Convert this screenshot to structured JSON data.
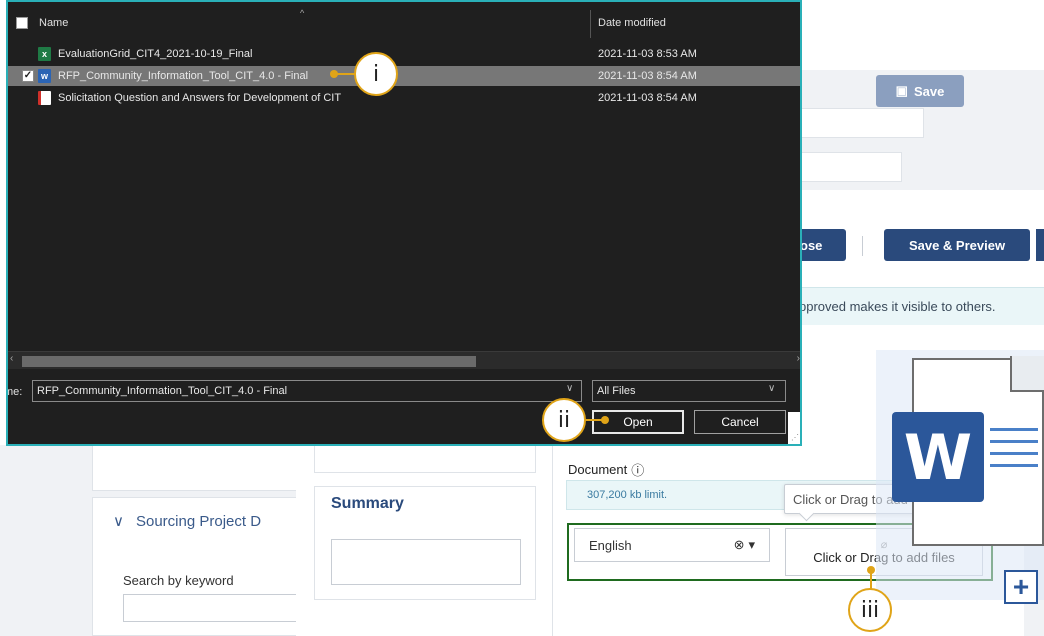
{
  "background_app": {
    "save_label": "Save",
    "close_label": "ose",
    "save_preview_label": "Save & Preview",
    "info_text": "pproved makes it visible to others.",
    "sourcing_heading": "Sourcing Project D",
    "search_label": "Search by keyword",
    "summary_title": "Summary",
    "document_label": "Document",
    "limit_text": "307,200 kb limit.",
    "language_value": "English",
    "add_files_label": "Click or Drag to add files",
    "tooltip_text": "Click or Drag to add files"
  },
  "file_dialog": {
    "columns": {
      "name": "Name",
      "date_modified": "Date modified"
    },
    "files": [
      {
        "name": "EvaluationGrid_CIT4_2021-10-19_Final",
        "date": "2021-11-03 8:53 AM",
        "type": "excel",
        "selected": false
      },
      {
        "name": "RFP_Community_Information_Tool_CIT_4.0 - Final",
        "date": "2021-11-03 8:54 AM",
        "type": "word",
        "selected": true
      },
      {
        "name": "Solicitation Question and Answers for Development of CIT",
        "date": "2021-11-03 8:54 AM",
        "type": "pdf",
        "selected": false
      }
    ],
    "filename_label": "me:",
    "filename_value": "RFP_Community_Information_Tool_CIT_4.0 - Final",
    "filetype_value": "All Files",
    "open_label": "Open",
    "cancel_label": "Cancel"
  },
  "drag_ghost": {
    "icon_letter": "W",
    "plus": "+"
  },
  "callouts": {
    "one": "i",
    "two": "ii",
    "three": "iii"
  },
  "colors": {
    "accent": "#e0a418",
    "dialog_border": "#2ab0b8",
    "brand_blue": "#2a4a7c",
    "word_blue": "#2b579a",
    "drop_zone_border": "#1f6b1f"
  }
}
